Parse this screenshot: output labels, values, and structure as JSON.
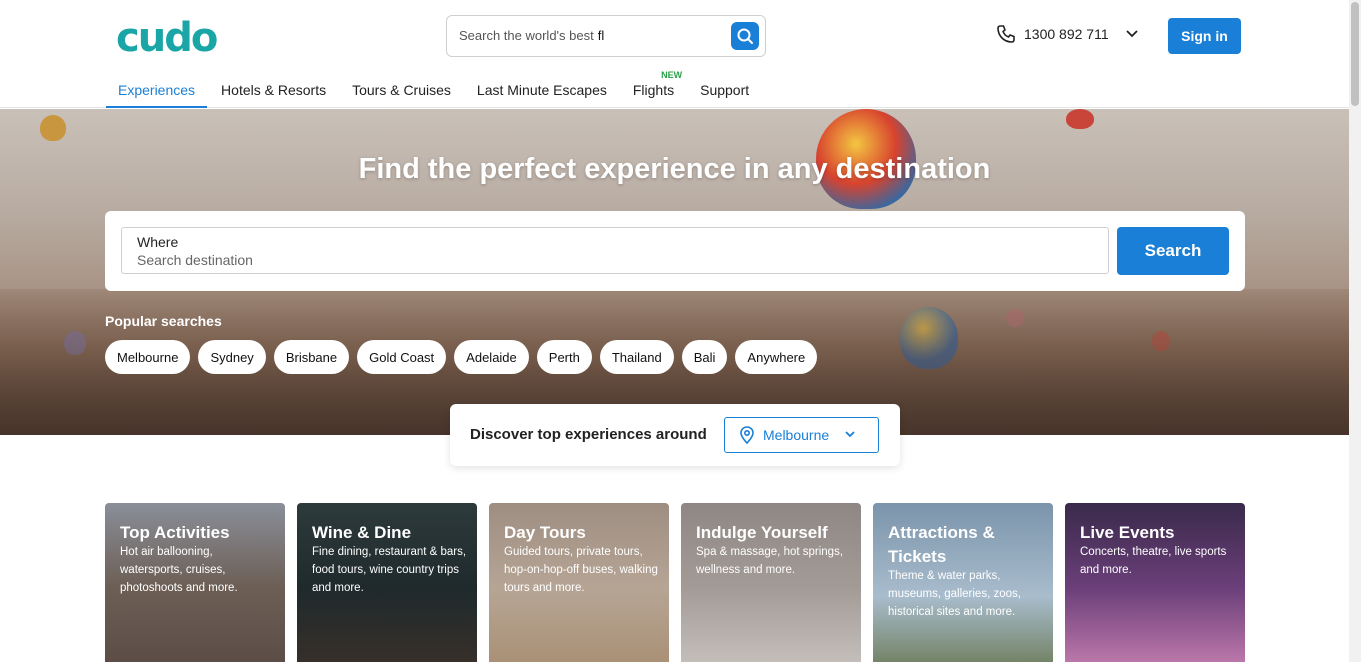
{
  "header": {
    "logo": "cudo",
    "search": {
      "placeholder": "Search the world's best",
      "typed": "fl"
    },
    "phone": "1300 892 711",
    "signin_label": "Sign in"
  },
  "nav": [
    {
      "label": "Experiences",
      "active": true
    },
    {
      "label": "Hotels & Resorts"
    },
    {
      "label": "Tours & Cruises"
    },
    {
      "label": "Last Minute Escapes"
    },
    {
      "label": "Flights",
      "badge": "NEW"
    },
    {
      "label": "Support"
    }
  ],
  "hero": {
    "title": "Find the perfect experience in any destination",
    "where_label": "Where",
    "where_placeholder": "Search destination",
    "search_label": "Search",
    "popular_label": "Popular searches",
    "chips": [
      "Melbourne",
      "Sydney",
      "Brisbane",
      "Gold Coast",
      "Adelaide",
      "Perth",
      "Thailand",
      "Bali",
      "Anywhere"
    ]
  },
  "discover": {
    "text": "Discover top experiences around",
    "location": "Melbourne"
  },
  "cards": [
    {
      "title": "Top Activities",
      "desc": "Hot air ballooning, watersports, cruises, photoshoots and more."
    },
    {
      "title": "Wine & Dine",
      "desc": "Fine dining, restaurant & bars, food tours, wine country trips and more."
    },
    {
      "title": "Day Tours",
      "desc": "Guided tours, private tours, hop-on-hop-off buses, walking tours and more."
    },
    {
      "title": "Indulge Yourself",
      "desc": "Spa & massage, hot springs, wellness and more."
    },
    {
      "title": "Attractions & Tickets",
      "desc": "Theme & water parks, museums, galleries, zoos, historical sites and more."
    },
    {
      "title": "Live Events",
      "desc": "Concerts, theatre, live sports and more."
    }
  ],
  "colors": {
    "brand": "#1aa6a6",
    "accent": "#1a7fd6",
    "new_badge": "#2ba14a"
  }
}
